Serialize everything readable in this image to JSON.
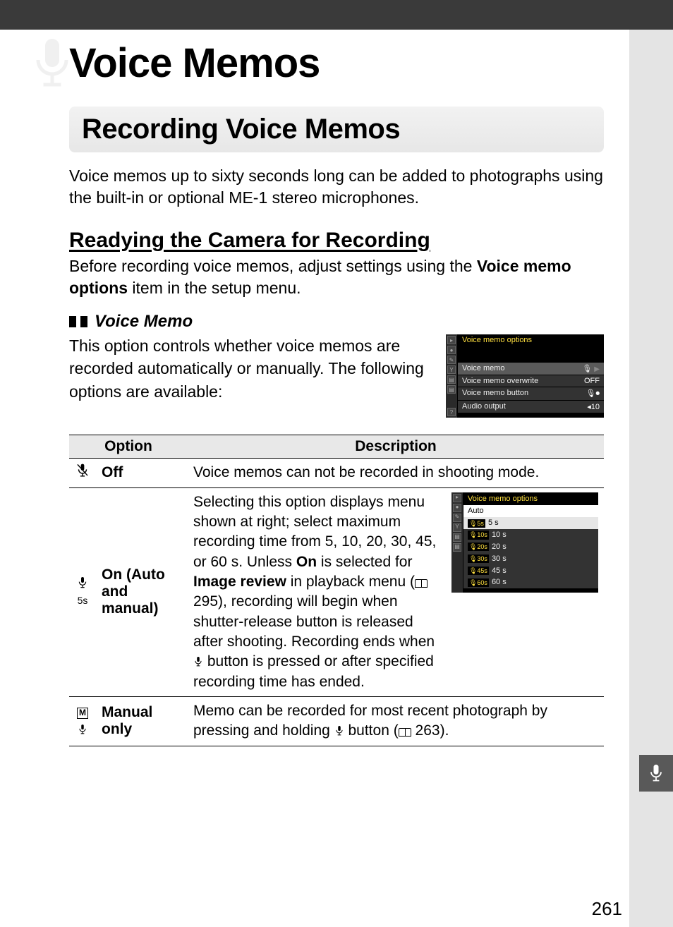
{
  "chapter_title": "Voice Memos",
  "section_title": "Recording Voice Memos",
  "intro": "Voice memos up to sixty seconds long can be added to photographs using the built-in or optional ME-1 stereo microphones.",
  "subheading": "Readying the Camera for Recording",
  "subbody_prefix": "Before recording voice memos, adjust settings using the ",
  "subbody_bold": "Voice memo options",
  "subbody_suffix": " item in the setup menu.",
  "bullet_title": "Voice Memo",
  "bullet_body": "This option controls whether voice memos are recorded automatically or manually.  The following options are available:",
  "screen1": {
    "title": "Voice memo options",
    "rows": [
      {
        "label": "Voice memo",
        "value": "",
        "icon": true,
        "arrow": true
      },
      {
        "label": "Voice memo overwrite",
        "value": "OFF"
      },
      {
        "label": "Voice memo button",
        "value": ""
      },
      {
        "label": "Audio output",
        "value": "◂10"
      }
    ]
  },
  "table": {
    "headers": [
      "Option",
      "Description"
    ],
    "rows": [
      {
        "icon": "mic-off",
        "label": "Off",
        "desc_plain": "Voice memos can not be recorded in shooting mode."
      },
      {
        "icon": "mic-5s",
        "label": "On (Auto and manual)",
        "desc_parts": {
          "a": "Selecting this option displays menu shown at right; select maximum recording time from 5, 10, 20, 30, 45, or 60 s.  Unless ",
          "b1": "On",
          "c": " is selected for ",
          "b2": "Image review",
          "d": " in playback menu (",
          "e": " 295), recording will begin when shutter-release button is released after shooting.  Recording ends when ",
          "f": " button is pressed or after specified recording time has ended."
        }
      },
      {
        "icon": "mic-m",
        "label": "Manual only",
        "desc_parts": {
          "a": "Memo can be recorded for most recent photograph by pressing and holding ",
          "b": " button (",
          "c": " 263)."
        }
      }
    ]
  },
  "screen2": {
    "title": "Voice memo options",
    "subtitle": "Auto",
    "rows": [
      {
        "tag": "5s",
        "label": "5 s",
        "selected": true
      },
      {
        "tag": "10s",
        "label": "10 s"
      },
      {
        "tag": "20s",
        "label": "20 s"
      },
      {
        "tag": "30s",
        "label": "30 s"
      },
      {
        "tag": "45s",
        "label": "45 s"
      },
      {
        "tag": "60s",
        "label": "60 s"
      }
    ]
  },
  "page_number": "261"
}
